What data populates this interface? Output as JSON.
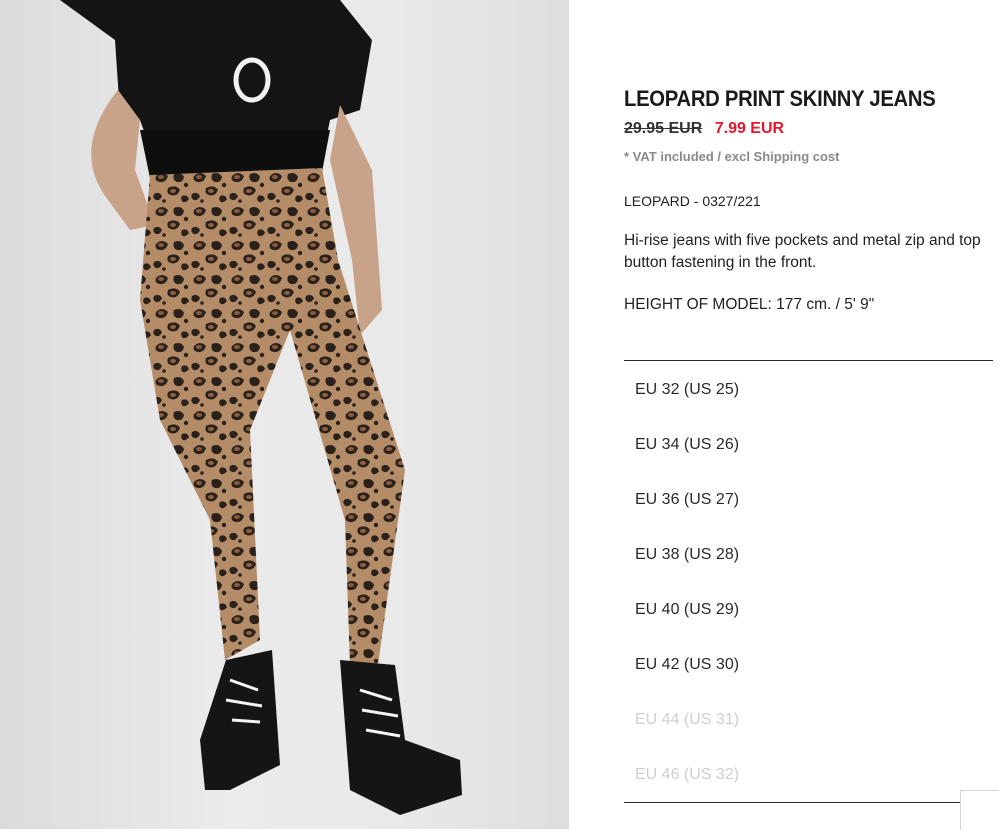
{
  "product": {
    "title": "LEOPARD PRINT SKINNY JEANS",
    "old_price": "29.95 EUR",
    "new_price": "7.99 EUR",
    "vat_note": "* VAT included / excl Shipping cost",
    "reference": "LEOPARD - 0327/221",
    "description": "Hi-rise jeans with five pockets and metal zip and top button fastening in the front.",
    "model_height": "HEIGHT OF MODEL: 177 cm. / 5' 9\""
  },
  "sizes": [
    {
      "label": "EU 32 (US 25)",
      "available": true
    },
    {
      "label": "EU 34 (US 26)",
      "available": true
    },
    {
      "label": "EU 36 (US 27)",
      "available": true
    },
    {
      "label": "EU 38 (US 28)",
      "available": true
    },
    {
      "label": "EU 40 (US 29)",
      "available": true
    },
    {
      "label": "EU 42 (US 30)",
      "available": true
    },
    {
      "label": "EU 44 (US 31)",
      "available": false
    },
    {
      "label": "EU 46 (US 32)",
      "available": false
    }
  ],
  "colors": {
    "sale_price": "#e4172b",
    "unavailable_size": "#cfcfcf"
  }
}
